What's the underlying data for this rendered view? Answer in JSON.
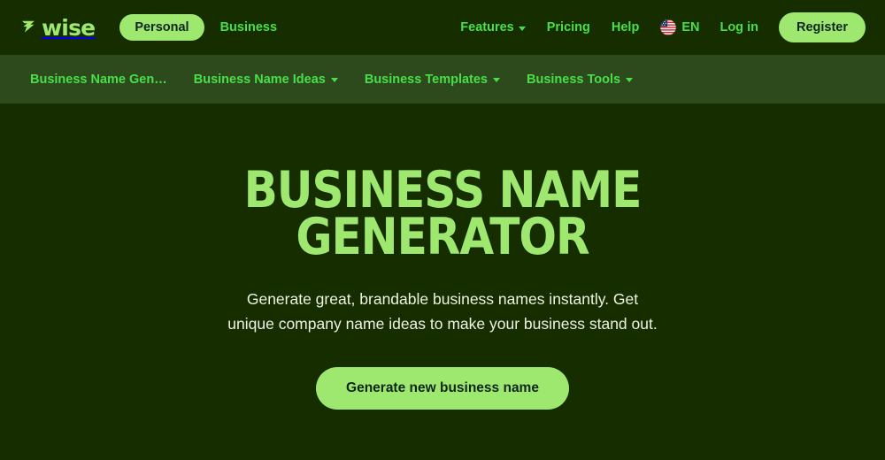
{
  "brand": {
    "name": "wise",
    "logo_icon": "wise-arrow-mark"
  },
  "header": {
    "audience": {
      "active_label": "Personal",
      "inactive_label": "Business"
    },
    "nav": [
      {
        "label": "Features",
        "has_dropdown": true,
        "icon": "chevron-down-icon"
      },
      {
        "label": "Pricing",
        "has_dropdown": false
      },
      {
        "label": "Help",
        "has_dropdown": false
      }
    ],
    "language": {
      "code": "EN",
      "flag_icon": "us-flag-icon"
    },
    "login_label": "Log in",
    "register_label": "Register"
  },
  "subnav": {
    "items": [
      {
        "label": "Business Name Gen…",
        "has_dropdown": false
      },
      {
        "label": "Business Name Ideas",
        "has_dropdown": true,
        "icon": "chevron-down-icon"
      },
      {
        "label": "Business Templates",
        "has_dropdown": true,
        "icon": "chevron-down-icon"
      },
      {
        "label": "Business Tools",
        "has_dropdown": true,
        "icon": "chevron-down-icon"
      }
    ]
  },
  "hero": {
    "title_line1": "BUSINESS NAME",
    "title_line2": "GENERATOR",
    "subtitle": "Generate great, brandable business names instantly. Get unique company name ideas to make your business stand out.",
    "cta_label": "Generate new business name"
  },
  "colors": {
    "page_background": "#162d00",
    "subnav_background": "#2c4a1c",
    "accent_green": "#9fe870",
    "link_green": "#4ade4a",
    "dark_text": "#10261a",
    "subtitle_text": "#edf3e2"
  }
}
